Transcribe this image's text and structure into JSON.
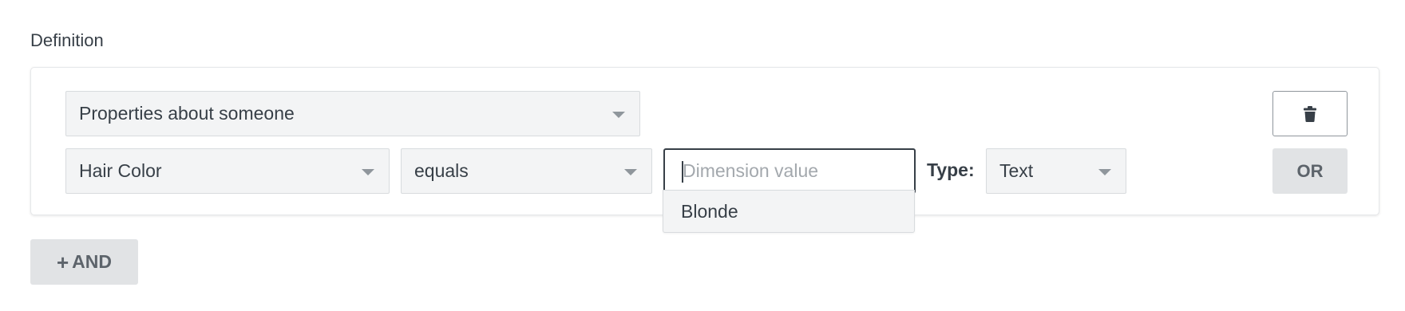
{
  "section": {
    "title": "Definition"
  },
  "condition": {
    "category": {
      "value": "Properties about someone"
    },
    "dimension": {
      "value": "Hair Color"
    },
    "operator": {
      "value": "equals"
    },
    "value_input": {
      "placeholder": "Dimension value",
      "value": ""
    },
    "type": {
      "label": "Type:",
      "value": "Text"
    },
    "suggestions": [
      "Blonde"
    ]
  },
  "buttons": {
    "or_label": "OR",
    "and_label": "AND",
    "and_prefix": "+"
  },
  "icons": {
    "delete": "trash-icon",
    "caret": "chevron-down-icon",
    "add": "plus-icon"
  },
  "colors": {
    "text": "#373f47",
    "select_bg": "#f3f4f5",
    "button_bg": "#e1e3e5",
    "button_text": "#5d646b",
    "input_border": "#373f47"
  }
}
